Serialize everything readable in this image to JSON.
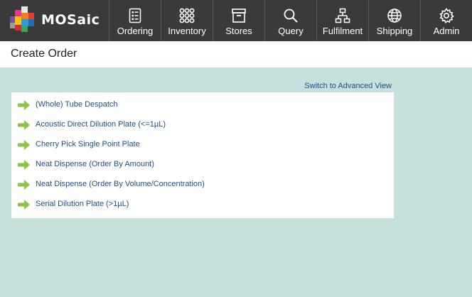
{
  "brand": {
    "name": "MOSaic"
  },
  "nav": {
    "items": [
      {
        "label": "Ordering",
        "icon": "clipboard-list-icon"
      },
      {
        "label": "Inventory",
        "icon": "grid-dots-icon"
      },
      {
        "label": "Stores",
        "icon": "storage-box-icon"
      },
      {
        "label": "Query",
        "icon": "magnifier-icon"
      },
      {
        "label": "Fulfilment",
        "icon": "hierarchy-icon"
      },
      {
        "label": "Shipping",
        "icon": "globe-icon"
      },
      {
        "label": "Admin",
        "icon": "gear-icon"
      }
    ]
  },
  "page": {
    "title": "Create Order",
    "switch_view_label": "Switch to Advanced View"
  },
  "order_types": [
    {
      "label": "(Whole) Tube Despatch"
    },
    {
      "label": "Acoustic Direct Dilution Plate (<=1µL)"
    },
    {
      "label": "Cherry Pick Single Point Plate"
    },
    {
      "label": "Neat Dispense (Order By Amount)"
    },
    {
      "label": "Neat Dispense (Order By Volume/Concentration)"
    },
    {
      "label": "Serial Dilution Plate (>1µL)"
    }
  ],
  "colors": {
    "topbar": "#3a3a3a",
    "background": "#c6e0dc",
    "link": "#1f4f82",
    "arrow": "#8cc63f"
  }
}
